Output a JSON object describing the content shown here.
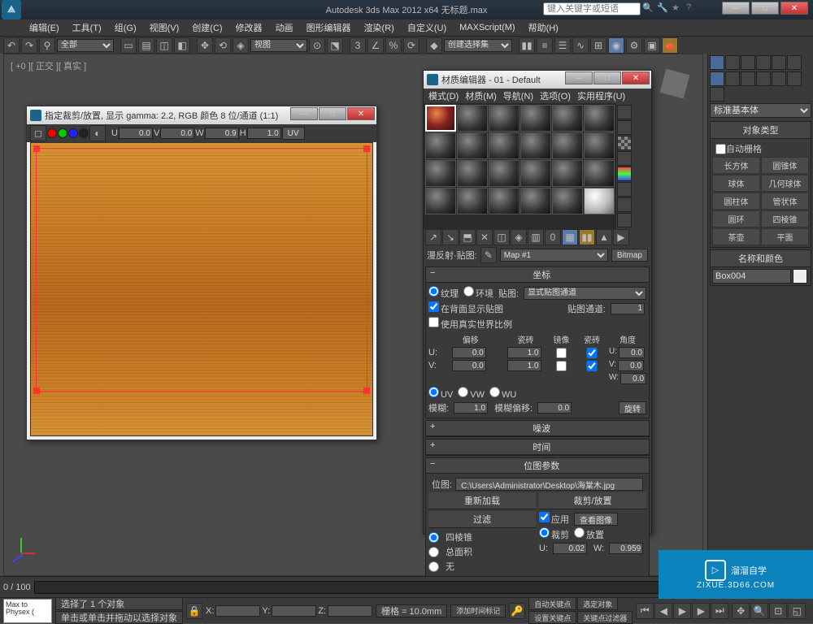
{
  "titlebar": {
    "title": "Autodesk 3ds Max  2012 x64    无标题.max",
    "search_placeholder": "键入关键字或短语"
  },
  "menus": [
    "编辑(E)",
    "工具(T)",
    "组(G)",
    "视图(V)",
    "创建(C)",
    "修改器",
    "动画",
    "图形编辑器",
    "渲染(R)",
    "自定义(U)",
    "MAXScript(M)",
    "帮助(H)"
  ],
  "toolbar": {
    "set_combo": "全部",
    "view_combo": "视图",
    "selset_combo": "创建选择集"
  },
  "viewport_label": "[ +0 ][ 正交 ][ 真实 ]",
  "tex_window": {
    "title": "指定裁剪/放置, 显示 gamma: 2.2, RGB 颜色 8 位/通道 (1:1)",
    "u_lbl": "U",
    "u_val": "0.0",
    "v_lbl": "V",
    "v_val": "0.0",
    "w_lbl": "W",
    "w_val": "0.9",
    "h_lbl": "H",
    "h_val": "1.0",
    "uv_btn": "UV"
  },
  "mat_editor": {
    "title": "材质编辑器 - 01 - Default",
    "menus": [
      "模式(D)",
      "材质(M)",
      "导航(N)",
      "选项(O)",
      "实用程序(U)"
    ],
    "map_label": "漫反射·贴图:",
    "map_name": "Map #1",
    "type_btn": "Bitmap",
    "coords_rollout": "坐标",
    "radio_texture": "纹理",
    "radio_env": "环境",
    "map_channel_lbl": "贴图:",
    "map_channel_sel": "显式贴图通道",
    "check_back": "在背面显示贴图",
    "check_world": "使用真实世界比例",
    "tile_channel_lbl": "贴图通道:",
    "tile_channel_val": "1",
    "hdr_offset": "偏移",
    "hdr_tile": "瓷砖",
    "hdr_mirror": "镜像",
    "hdr_tile2": "瓷砖",
    "hdr_angle": "角度",
    "u_lbl": "U:",
    "u_off": "0.0",
    "u_tile": "1.0",
    "u_ang": "0.0",
    "v_lbl": "V:",
    "v_off": "0.0",
    "v_tile": "1.0",
    "v_ang": "0.0",
    "w_lbl": "W:",
    "w_ang": "0.0",
    "uv_r": "UV",
    "vw_r": "VW",
    "wu_r": "WU",
    "blur_lbl": "模糊:",
    "blur_val": "1.0",
    "bluro_lbl": "模糊偏移:",
    "bluro_val": "0.0",
    "rotate_btn": "旋转",
    "noise_rollout": "噪波",
    "time_rollout": "时间",
    "bmp_rollout": "位图参数",
    "bitmap_lbl": "位图:",
    "bitmap_path": "C:\\Users\\Administrator\\Desktop\\海棠木.jpg",
    "reload_lbl": "重新加载",
    "crop_lbl": "裁剪/放置",
    "filter_lbl": "过滤",
    "filter_pyramid": "四棱锥",
    "filter_summed": "总面积",
    "filter_none": "无",
    "apply_chk": "应用",
    "view_img_btn": "查看图像",
    "crop_radio": "裁剪",
    "place_radio": "放置",
    "cu_lbl": "U:",
    "cu_val": "0.02",
    "cw_lbl": "W:",
    "cw_val": "0.959"
  },
  "right_panel": {
    "category": "标准基本体",
    "obj_type": "对象类型",
    "autogrid": "自动栅格",
    "shapes": [
      "长方体",
      "圆锥体",
      "球体",
      "几何球体",
      "圆柱体",
      "管状体",
      "圆环",
      "四棱锥",
      "茶壶",
      "平面"
    ],
    "name_color": "名称和颜色",
    "name_val": "Box004"
  },
  "timeline": {
    "range": "0 / 100"
  },
  "status": {
    "sel_count": "选择了 1 个对象",
    "hint_click": "单击或单击并拖动以选择对象",
    "hint_time": "添加时间标记",
    "x_lbl": "X:",
    "y_lbl": "Y:",
    "z_lbl": "Z:",
    "grid_lbl": "栅格 = 10.0mm",
    "autokey": "自动关键点",
    "selected": "选定对象",
    "setkey": "设置关键点",
    "keyfilter": "关键点过滤器"
  },
  "maxscript": "Max to Physex (",
  "watermark": {
    "brand": "溜溜自学",
    "url": "ZIXUE.3D66.COM"
  }
}
